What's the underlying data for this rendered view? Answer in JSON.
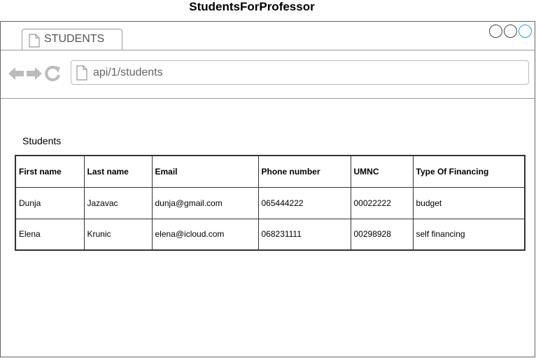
{
  "diagram_title": "StudentsForProfessor",
  "browser": {
    "tab_label": "STUDENTS",
    "address": "api/1/students"
  },
  "icons": [
    "page-icon",
    "back-icon",
    "forward-icon",
    "reload-icon",
    "window-button-icon"
  ],
  "colors": {
    "active_window_button": "#1ba1e2",
    "border": "#333333"
  },
  "section_label": "Students",
  "table": {
    "headers": [
      "First name",
      "Last name",
      "Email",
      "Phone number",
      "UMNC",
      "Type Of Financing"
    ],
    "rows": [
      [
        "Dunja",
        "Jazavac",
        "dunja@gmail.com",
        "065444222",
        "00022222",
        "budget"
      ],
      [
        "Elena",
        "Krunic",
        "elena@icloud.com",
        "068231111",
        "00298928",
        "self financing"
      ]
    ]
  }
}
